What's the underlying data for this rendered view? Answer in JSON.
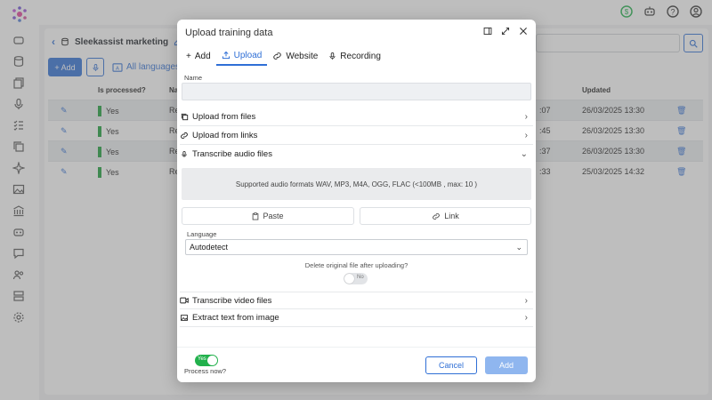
{
  "app": {
    "breadcrumb_title": "Sleekassist marketing",
    "add_button": "+ Add",
    "languages_link": "All languages"
  },
  "table": {
    "headers": [
      "Is processed?",
      "Na",
      "Updated"
    ],
    "rows": [
      {
        "processed": "Yes",
        "name": "Re",
        "time": ":07",
        "updated": "26/03/2025 13:30"
      },
      {
        "processed": "Yes",
        "name": "Re",
        "time": ":45",
        "updated": "26/03/2025 13:30"
      },
      {
        "processed": "Yes",
        "name": "Re",
        "time": ":37",
        "updated": "26/03/2025 13:30"
      },
      {
        "processed": "Yes",
        "name": "Re",
        "time": ":33",
        "updated": "25/03/2025 14:32"
      }
    ]
  },
  "modal": {
    "title": "Upload training data",
    "tabs": [
      {
        "label": "Add",
        "icon": "plus-icon"
      },
      {
        "label": "Upload",
        "icon": "upload-icon"
      },
      {
        "label": "Website",
        "icon": "link-icon"
      },
      {
        "label": "Recording",
        "icon": "mic-icon"
      }
    ],
    "name_label": "Name",
    "name_value": "",
    "sections": {
      "upload_files": "Upload from files",
      "upload_links": "Upload from links",
      "transcribe_audio": "Transcribe audio files",
      "transcribe_video": "Transcribe video files",
      "extract_text": "Extract text from image"
    },
    "dropzone_text": "Supported audio formats WAV, MP3, M4A, OGG, FLAC (<100MB , max: 10 )",
    "paste_label": "Paste",
    "link_label": "Link",
    "language_label": "Language",
    "language_value": "Autodetect",
    "delete_original_label": "Delete original file after uploading?",
    "delete_toggle_text": "No",
    "process_toggle_text": "Yes",
    "process_label": "Process now?",
    "cancel_label": "Cancel",
    "add_label": "Add"
  },
  "colors": {
    "accent": "#2f6fd6",
    "success": "#22b14c",
    "status_green": "#1a9e3a",
    "add_disabled": "#8fb6ef"
  }
}
